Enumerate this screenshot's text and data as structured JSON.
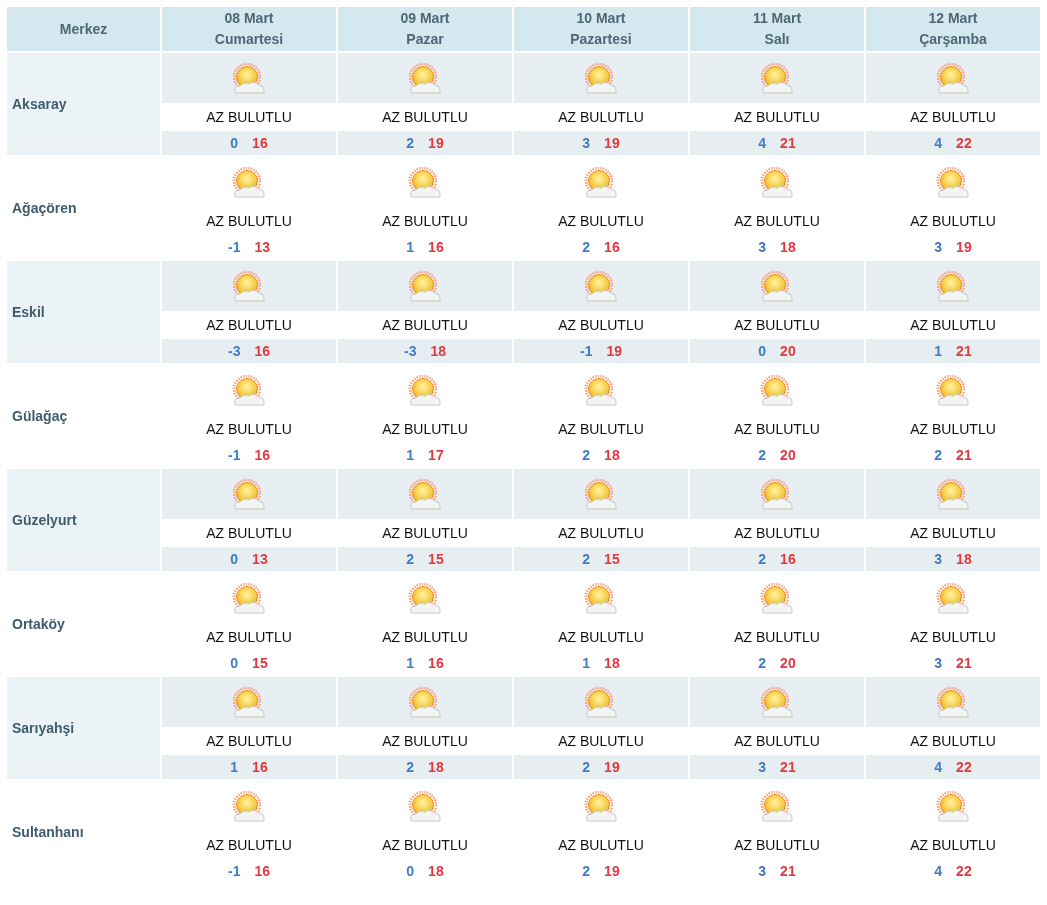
{
  "table": {
    "corner": "Merkez",
    "columns": [
      {
        "date": "08 Mart",
        "weekday": "Cumartesi"
      },
      {
        "date": "09 Mart",
        "weekday": "Pazar"
      },
      {
        "date": "10 Mart",
        "weekday": "Pazartesi"
      },
      {
        "date": "11 Mart",
        "weekday": "Salı"
      },
      {
        "date": "12 Mart",
        "weekday": "Çarşamba"
      }
    ],
    "rows": [
      {
        "name": "Aksaray",
        "days": [
          {
            "condition": "AZ BULUTLU",
            "low": "0",
            "high": "16"
          },
          {
            "condition": "AZ BULUTLU",
            "low": "2",
            "high": "19"
          },
          {
            "condition": "AZ BULUTLU",
            "low": "3",
            "high": "19"
          },
          {
            "condition": "AZ BULUTLU",
            "low": "4",
            "high": "21"
          },
          {
            "condition": "AZ BULUTLU",
            "low": "4",
            "high": "22"
          }
        ]
      },
      {
        "name": "Ağaçören",
        "days": [
          {
            "condition": "AZ BULUTLU",
            "low": "-1",
            "high": "13"
          },
          {
            "condition": "AZ BULUTLU",
            "low": "1",
            "high": "16"
          },
          {
            "condition": "AZ BULUTLU",
            "low": "2",
            "high": "16"
          },
          {
            "condition": "AZ BULUTLU",
            "low": "3",
            "high": "18"
          },
          {
            "condition": "AZ BULUTLU",
            "low": "3",
            "high": "19"
          }
        ]
      },
      {
        "name": "Eskil",
        "days": [
          {
            "condition": "AZ BULUTLU",
            "low": "-3",
            "high": "16"
          },
          {
            "condition": "AZ BULUTLU",
            "low": "-3",
            "high": "18"
          },
          {
            "condition": "AZ BULUTLU",
            "low": "-1",
            "high": "19"
          },
          {
            "condition": "AZ BULUTLU",
            "low": "0",
            "high": "20"
          },
          {
            "condition": "AZ BULUTLU",
            "low": "1",
            "high": "21"
          }
        ]
      },
      {
        "name": "Gülağaç",
        "days": [
          {
            "condition": "AZ BULUTLU",
            "low": "-1",
            "high": "16"
          },
          {
            "condition": "AZ BULUTLU",
            "low": "1",
            "high": "17"
          },
          {
            "condition": "AZ BULUTLU",
            "low": "2",
            "high": "18"
          },
          {
            "condition": "AZ BULUTLU",
            "low": "2",
            "high": "20"
          },
          {
            "condition": "AZ BULUTLU",
            "low": "2",
            "high": "21"
          }
        ]
      },
      {
        "name": "Güzelyurt",
        "days": [
          {
            "condition": "AZ BULUTLU",
            "low": "0",
            "high": "13"
          },
          {
            "condition": "AZ BULUTLU",
            "low": "2",
            "high": "15"
          },
          {
            "condition": "AZ BULUTLU",
            "low": "2",
            "high": "15"
          },
          {
            "condition": "AZ BULUTLU",
            "low": "2",
            "high": "16"
          },
          {
            "condition": "AZ BULUTLU",
            "low": "3",
            "high": "18"
          }
        ]
      },
      {
        "name": "Ortaköy",
        "days": [
          {
            "condition": "AZ BULUTLU",
            "low": "0",
            "high": "15"
          },
          {
            "condition": "AZ BULUTLU",
            "low": "1",
            "high": "16"
          },
          {
            "condition": "AZ BULUTLU",
            "low": "1",
            "high": "18"
          },
          {
            "condition": "AZ BULUTLU",
            "low": "2",
            "high": "20"
          },
          {
            "condition": "AZ BULUTLU",
            "low": "3",
            "high": "21"
          }
        ]
      },
      {
        "name": "Sarıyahşi",
        "days": [
          {
            "condition": "AZ BULUTLU",
            "low": "1",
            "high": "16"
          },
          {
            "condition": "AZ BULUTLU",
            "low": "2",
            "high": "18"
          },
          {
            "condition": "AZ BULUTLU",
            "low": "2",
            "high": "19"
          },
          {
            "condition": "AZ BULUTLU",
            "low": "3",
            "high": "21"
          },
          {
            "condition": "AZ BULUTLU",
            "low": "4",
            "high": "22"
          }
        ]
      },
      {
        "name": "Sultanhanı",
        "days": [
          {
            "condition": "AZ BULUTLU",
            "low": "-1",
            "high": "16"
          },
          {
            "condition": "AZ BULUTLU",
            "low": "0",
            "high": "18"
          },
          {
            "condition": "AZ BULUTLU",
            "low": "2",
            "high": "19"
          },
          {
            "condition": "AZ BULUTLU",
            "low": "3",
            "high": "21"
          },
          {
            "condition": "AZ BULUTLU",
            "low": "4",
            "high": "22"
          }
        ]
      }
    ]
  }
}
